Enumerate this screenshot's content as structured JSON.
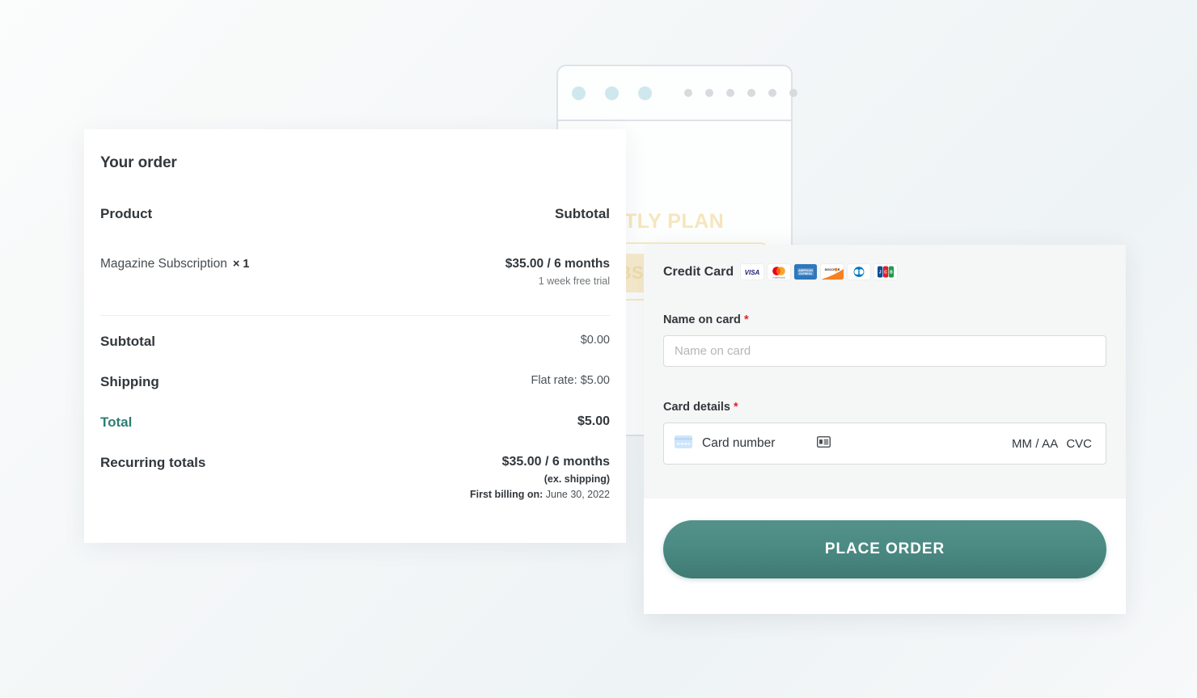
{
  "background_illustration": {
    "plan_title": "MONTLY PLAN",
    "subscribe_label": "SUBSCRIBE!",
    "dots": {
      "primary_count": 3,
      "secondary_count": 6,
      "primary_color": "#cfe8ee",
      "secondary_color": "#d7dbde"
    },
    "cursor_icon": "cursor-arrow-icon"
  },
  "order": {
    "title": "Your order",
    "columns": {
      "product": "Product",
      "subtotal": "Subtotal"
    },
    "line_items": [
      {
        "name": "Magazine Subscription",
        "quantity": "× 1",
        "price": "$35.00 / 6 months",
        "note": "1 week free trial"
      }
    ],
    "totals": [
      {
        "label": "Subtotal",
        "value": "$0.00",
        "accent": false,
        "bold": false
      },
      {
        "label": "Shipping",
        "value": "Flat rate: $5.00",
        "accent": false,
        "bold": false
      },
      {
        "label": "Total",
        "value": "$5.00",
        "accent": true,
        "bold": true
      },
      {
        "label": "Recurring totals",
        "value": "$35.00 / 6 months",
        "accent": false,
        "bold": true
      }
    ],
    "recurring_notes": {
      "ex_shipping": "(ex. shipping)",
      "first_billing_label": "First billing on:",
      "first_billing_date": "June 30, 2022"
    },
    "accent_color": "#2e7d74"
  },
  "credit_card": {
    "title": "Credit Card",
    "accepted_cards": [
      {
        "name": "visa-logo",
        "label": "VISA"
      },
      {
        "name": "mastercard-logo",
        "label": "mastercard"
      },
      {
        "name": "amex-logo",
        "label": "AMERICAN EXPRESS"
      },
      {
        "name": "discover-logo",
        "label": "DISCOVER"
      },
      {
        "name": "diners-club-logo",
        "label": "Diners Club"
      },
      {
        "name": "jcb-logo",
        "label": "JCB"
      }
    ],
    "name_field": {
      "label": "Name on card",
      "required_marker": "*",
      "placeholder": "Name on card",
      "value": ""
    },
    "card_details": {
      "label": "Card details",
      "required_marker": "*",
      "card_number_placeholder": "Card number",
      "expiry_placeholder": "MM / AA",
      "cvc_placeholder": "CVC"
    },
    "place_order_label": "PLACE ORDER",
    "button_color": "#4b8b83",
    "required_color": "#e3242b"
  }
}
